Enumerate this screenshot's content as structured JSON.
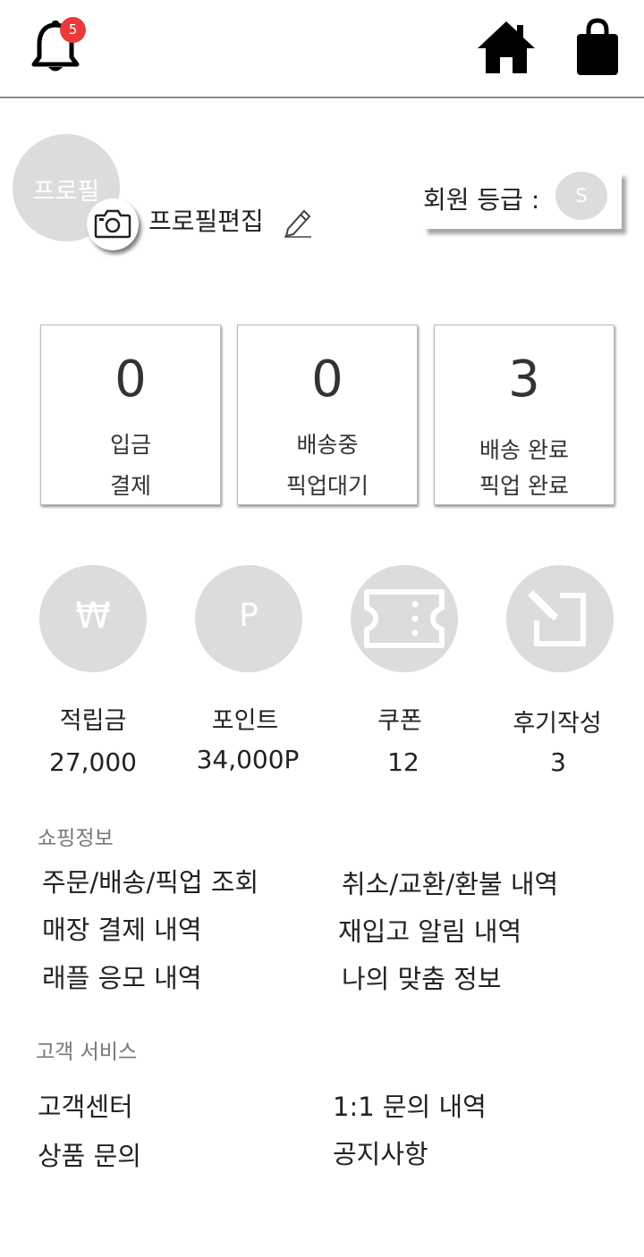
{
  "header": {
    "notification_count": "5",
    "icons": [
      "bell-icon",
      "home-icon",
      "shopping-bag-icon"
    ]
  },
  "profile": {
    "avatar_text": "프로필",
    "edit_label": "프로필편집",
    "grade_label": "회원 등급 :",
    "grade_value": "S"
  },
  "order_status": [
    {
      "count": "0",
      "line1": "입금",
      "line2": "결제"
    },
    {
      "count": "0",
      "line1": "배송중",
      "line2": "픽업대기"
    },
    {
      "count": "3",
      "line1": "배송 완료",
      "line2": "픽업 완료"
    }
  ],
  "benefits": [
    {
      "icon": "won-icon",
      "glyph": "₩",
      "label": "적립금",
      "value": "27,000"
    },
    {
      "icon": "point-icon",
      "glyph": "P",
      "label": "포인트",
      "value": "34,000P"
    },
    {
      "icon": "coupon-icon",
      "label": "쿠폰",
      "value": "12"
    },
    {
      "icon": "review-write-icon",
      "label": "후기작성",
      "value": "3"
    }
  ],
  "shopping": {
    "title": "쇼핑정보",
    "items": [
      "주문/배송/픽업 조회",
      "취소/교환/환불 내역",
      "매장 결제 내역",
      "재입고 알림 내역",
      "래플 응모 내역",
      "나의 맞춤 정보"
    ]
  },
  "service": {
    "title": "고객 서비스",
    "items": [
      "고객센터",
      "1:1 문의 내역",
      "상품 문의",
      "공지사항"
    ]
  },
  "colors": {
    "badge": "#e83a3a",
    "placeholder_gray": "#dcdcdc",
    "divider": "#8a8a8a"
  }
}
